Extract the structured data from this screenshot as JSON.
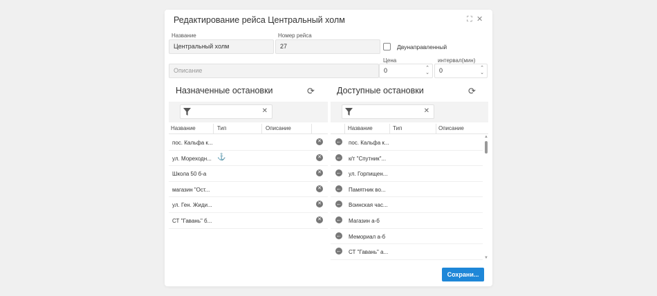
{
  "dialog": {
    "title": "Редактирование рейса Центральный холм",
    "maximize_icon": "⛶",
    "close_icon": "✕"
  },
  "form": {
    "name_label": "Название",
    "name_value": "Центральный холм",
    "number_label": "Номер рейса",
    "number_value": "27",
    "bidirectional_label": "Двунаправленный",
    "bidirectional_checked": false,
    "description_placeholder": "Описание",
    "price_label": "Цена",
    "price_value": "0",
    "interval_label": "интервал(мин)",
    "interval_value": "0"
  },
  "assigned": {
    "title": "Назначенные остановки",
    "columns": [
      "Название",
      "Тип",
      "Описание"
    ],
    "rows": [
      {
        "name": "пос. Кальфа к...",
        "type_icon": "anchor-icon"
      },
      {
        "name": "ул. Мореходн...",
        "type_icon": "anchor-icon",
        "show_type": true
      },
      {
        "name": "Школа 50 б-а"
      },
      {
        "name": "магазин \"Ост..."
      },
      {
        "name": "ул. Ген. Жиди..."
      },
      {
        "name": "СТ \"Гавань\" б..."
      }
    ]
  },
  "available": {
    "title": "Доступные остановки",
    "columns": [
      "Название",
      "Тип",
      "Описание"
    ],
    "rows": [
      {
        "name": "пос. Кальфа к..."
      },
      {
        "name": "к/т \"Спутник\"..."
      },
      {
        "name": "ул. Горпищен..."
      },
      {
        "name": "Памятник во..."
      },
      {
        "name": "Воинская час..."
      },
      {
        "name": "Магазин а-б"
      },
      {
        "name": "Мемориал а-б"
      },
      {
        "name": "СТ \"Гавань\" а..."
      }
    ]
  },
  "footer": {
    "save_label": "Сохрани..."
  },
  "colors": {
    "primary": "#1e87d8",
    "background": "#f0f0f0"
  }
}
